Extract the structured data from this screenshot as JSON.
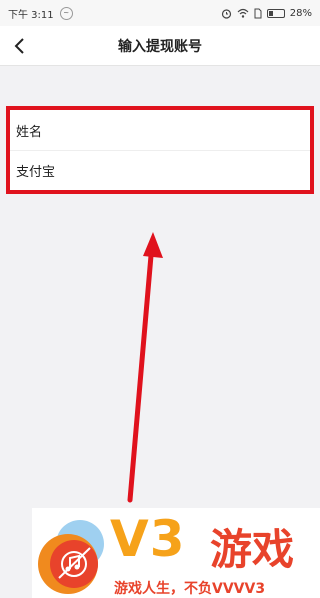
{
  "status_bar": {
    "time": "下午 3:11",
    "notification_glyph": "~",
    "battery": "28%",
    "battery_level": 0.28,
    "icons": [
      "alarm-icon",
      "wifi-icon",
      "sim-icon",
      "battery-icon"
    ]
  },
  "nav": {
    "back_icon": "chevron-left-icon",
    "title": "输入提现账号"
  },
  "form": {
    "fields": [
      {
        "label": "姓名"
      },
      {
        "label": "支付宝"
      }
    ]
  },
  "watermark": {
    "brand": "V3",
    "name": "游戏",
    "slogan": "游戏人生，不负VVVV3"
  },
  "colors": {
    "highlight_red": "#e0121d",
    "brand_orange": "#f6a21a",
    "brand_red": "#e8432b"
  }
}
